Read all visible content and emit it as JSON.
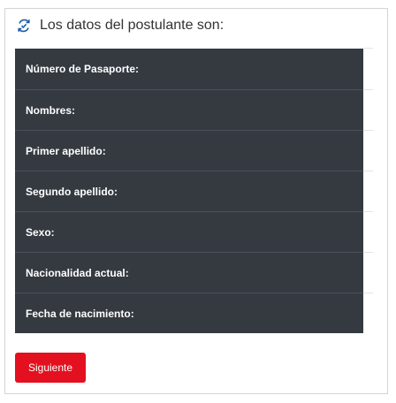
{
  "header": {
    "icon": "refresh-icon",
    "title": "Los datos del postulante son:"
  },
  "fields": [
    {
      "label": "Número de Pasaporte:"
    },
    {
      "label": "Nombres:"
    },
    {
      "label": "Primer apellido:"
    },
    {
      "label": "Segundo apellido:"
    },
    {
      "label": "Sexo:"
    },
    {
      "label": "Nacionalidad actual:"
    },
    {
      "label": "Fecha de nacimiento:"
    }
  ],
  "actions": {
    "next_label": "Siguiente"
  },
  "colors": {
    "table_bg": "#343a40",
    "button_bg": "#e3101f",
    "icon": "#1a5fa8"
  }
}
